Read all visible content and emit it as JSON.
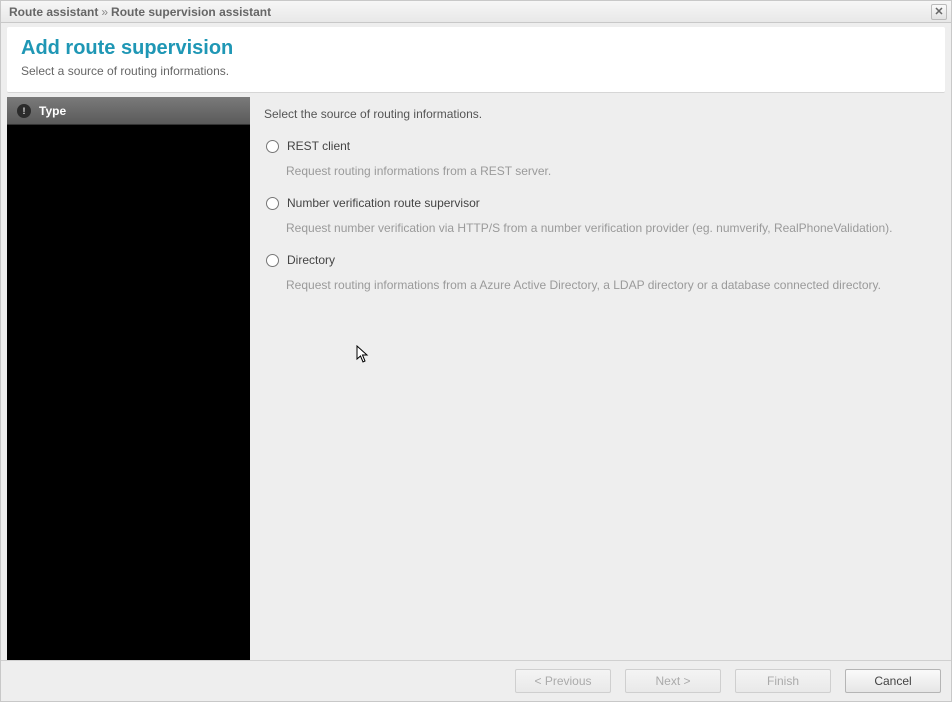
{
  "titlebar": {
    "crumb1": "Route assistant",
    "sep": "»",
    "crumb2": "Route supervision assistant"
  },
  "header": {
    "title": "Add route supervision",
    "subtitle": "Select a source of routing informations."
  },
  "sidebar": {
    "steps": [
      {
        "label": "Type"
      }
    ]
  },
  "content": {
    "heading": "Select the source of routing informations.",
    "options": [
      {
        "label": "REST client",
        "description": "Request routing informations from a REST server."
      },
      {
        "label": "Number verification route supervisor",
        "description": "Request number verification via HTTP/S from a number verification provider (eg. numverify, RealPhoneValidation)."
      },
      {
        "label": "Directory",
        "description": "Request routing informations from a Azure Active Directory, a LDAP directory or a database connected directory."
      }
    ]
  },
  "footer": {
    "previous": "< Previous",
    "next": "Next >",
    "finish": "Finish",
    "cancel": "Cancel"
  }
}
